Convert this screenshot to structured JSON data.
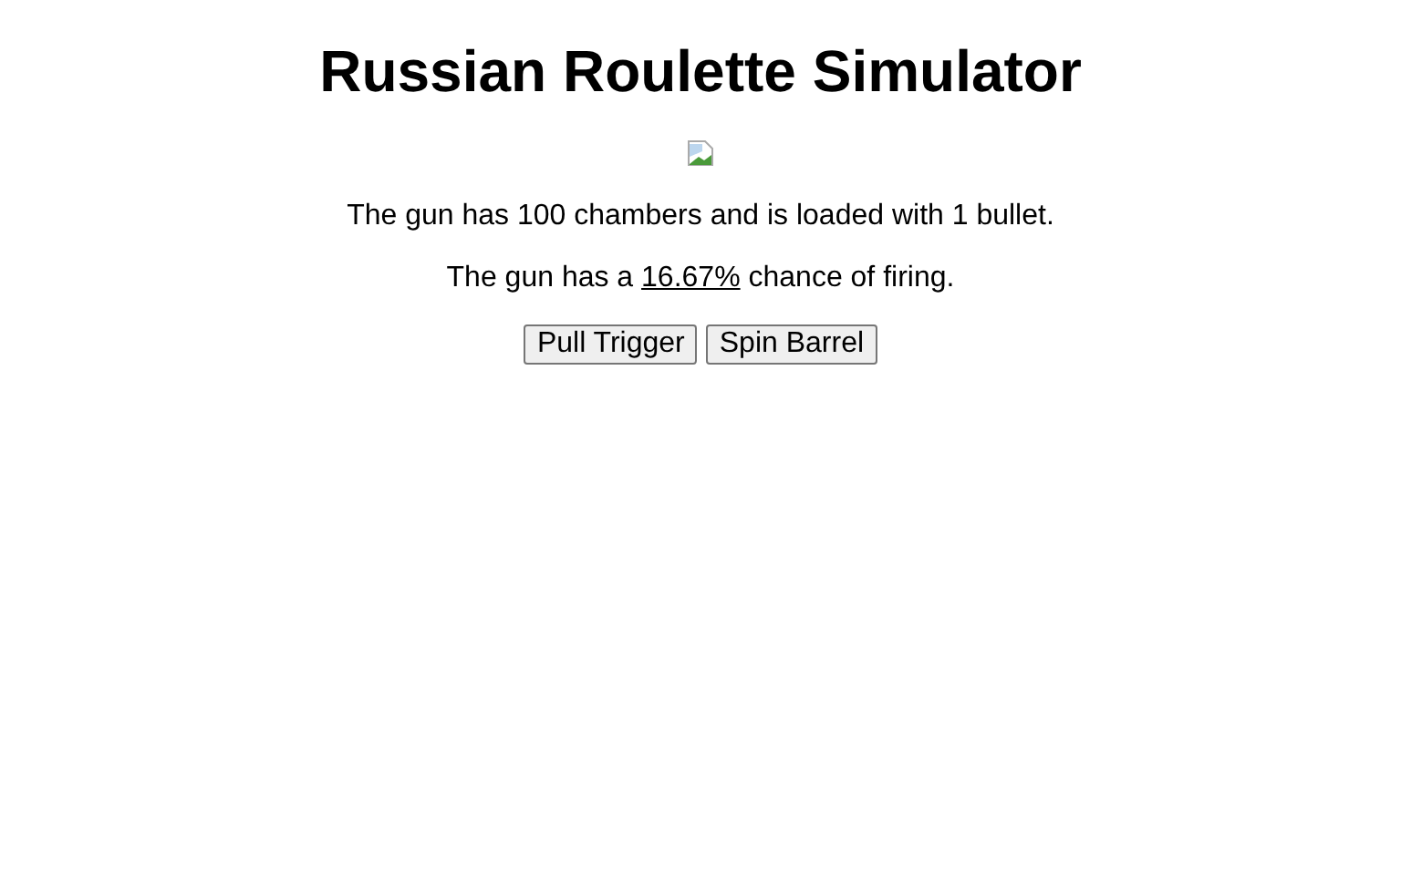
{
  "title": "Russian Roulette Simulator",
  "image": {
    "kind": "broken"
  },
  "info": "The gun has 100 chambers and is loaded with 1 bullet.",
  "chance": {
    "before": "The gun has a ",
    "value": "16.67%",
    "after": " chance of firing."
  },
  "buttons": [
    {
      "label": "Pull Trigger"
    },
    {
      "label": "Spin Barrel"
    }
  ]
}
